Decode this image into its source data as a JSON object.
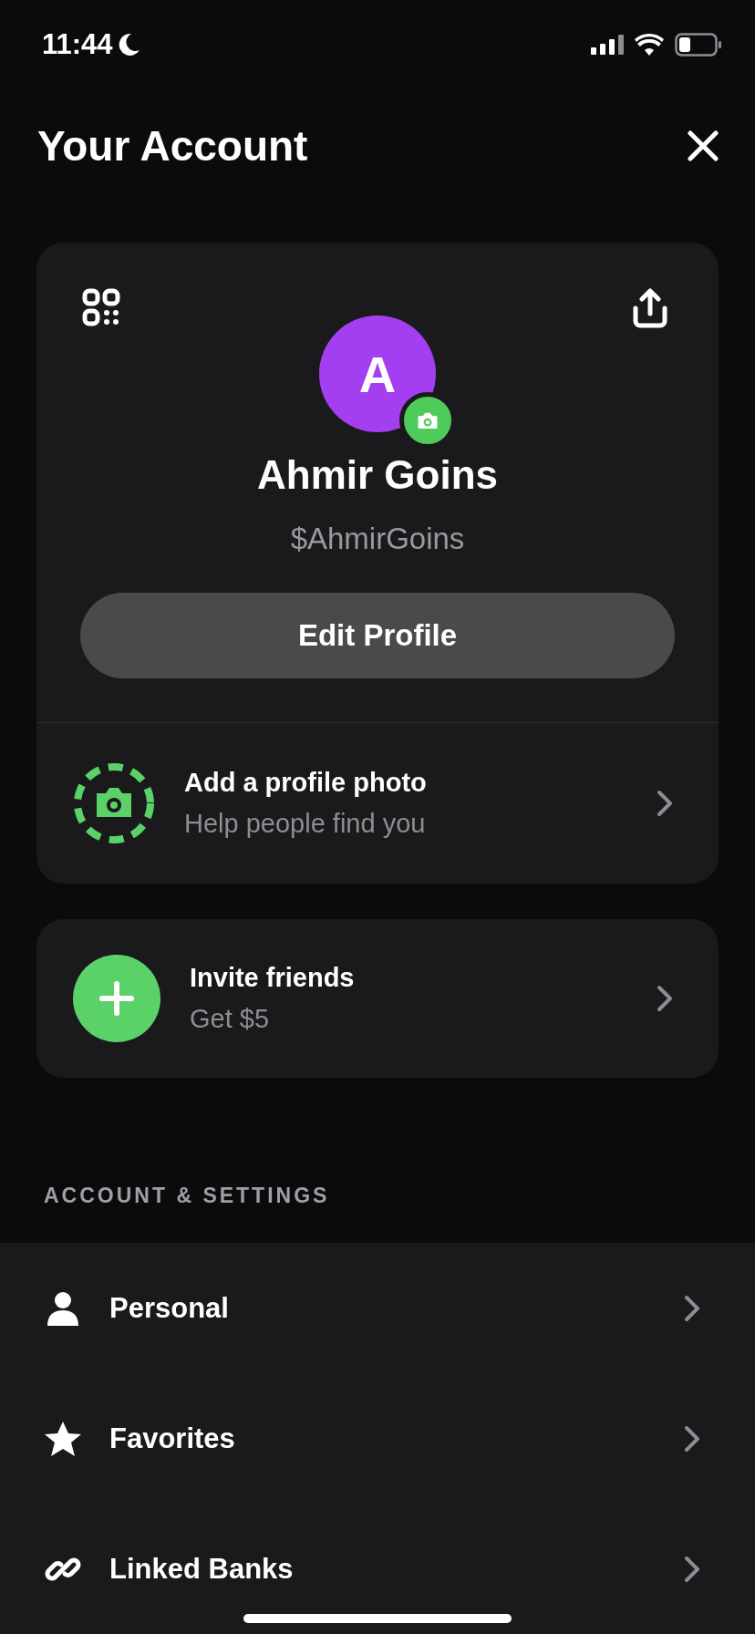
{
  "status_bar": {
    "time": "11:44"
  },
  "header": {
    "title": "Your Account"
  },
  "profile": {
    "initial": "A",
    "name": "Ahmir Goins",
    "cashtag": "$AhmirGoins",
    "edit_button": "Edit Profile"
  },
  "profile_prompt": {
    "title": "Add a profile photo",
    "subtitle": "Help people find you"
  },
  "invite": {
    "title": "Invite friends",
    "subtitle": "Get $5"
  },
  "section_header": "ACCOUNT & SETTINGS",
  "settings": [
    {
      "kind": "person",
      "label": "Personal"
    },
    {
      "kind": "star",
      "label": "Favorites"
    },
    {
      "kind": "link",
      "label": "Linked Banks"
    }
  ]
}
